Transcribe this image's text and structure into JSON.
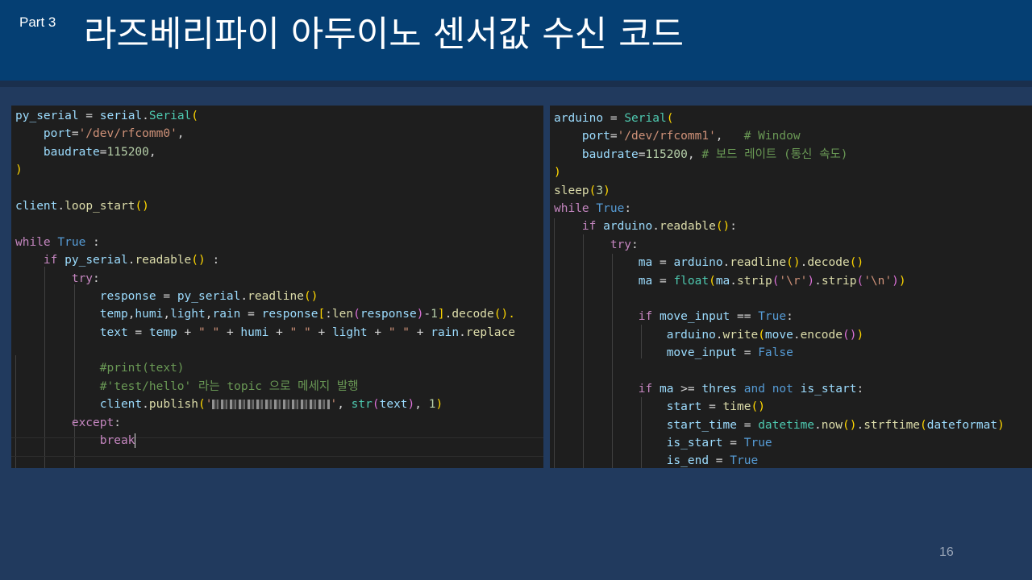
{
  "header": {
    "part_label": "Part 3",
    "title": "라즈베리파이 아두이노 센서값 수신 코드"
  },
  "left_code": {
    "l1": {
      "a": "py_serial",
      "b": " = ",
      "c": "serial",
      "d": ".",
      "e": "Serial",
      "f": "("
    },
    "l2": {
      "a": "    ",
      "b": "port",
      "c": "=",
      "d": "'/dev/rfcomm0'",
      "e": ","
    },
    "l3": {
      "a": "    ",
      "b": "baudrate",
      "c": "=",
      "d": "115200",
      "e": ","
    },
    "l4": {
      "a": ")"
    },
    "l6": {
      "a": "client",
      "b": ".",
      "c": "loop_start",
      "d": "()"
    },
    "l8": {
      "a": "while",
      "b": " ",
      "c": "True",
      "d": " :"
    },
    "l9": {
      "a": "    ",
      "b": "if",
      "c": " ",
      "d": "py_serial",
      "e": ".",
      "f": "readable",
      "g": "()",
      "h": " :"
    },
    "l10": {
      "a": "        ",
      "b": "try",
      "c": ":"
    },
    "l11": {
      "a": "            ",
      "b": "response",
      "c": " = ",
      "d": "py_serial",
      "e": ".",
      "f": "readline",
      "g": "()"
    },
    "l12": {
      "a": "            ",
      "b": "temp",
      "c": ",",
      "d": "humi",
      "e": ",",
      "f": "light",
      "g": ",",
      "h": "rain",
      "i": " = ",
      "j": "response",
      "k": "[",
      "l": ":",
      "m": "len",
      "n": "(",
      "o": "response",
      "p": ")",
      "q": "-",
      "r": "1",
      "s": "]",
      "t": ".",
      "u": "decode",
      "v": "().",
      "w": ""
    },
    "l13": {
      "a": "            ",
      "b": "text",
      "c": " = ",
      "d": "temp",
      "e": " + ",
      "f": "\" \"",
      "g": " + ",
      "h": "humi",
      "i": " + ",
      "j": "\" \"",
      "k": " + ",
      "l": "light",
      "m": " + ",
      "n": "\" \"",
      "o": " + ",
      "p": "rain",
      "q": ".",
      "r": "replace"
    },
    "l15": {
      "a": "            ",
      "b": "#print(text)"
    },
    "l16": {
      "a": "            ",
      "b": "#'test/hello' 라는 topic 으로 메세지 발행"
    },
    "l17": {
      "a": "            ",
      "b": "client",
      "c": ".",
      "d": "publish",
      "e": "(",
      "f": "'",
      "g": "'",
      "h": ", ",
      "i": "str",
      "j": "(",
      "k": "text",
      "l": ")",
      "m": ", ",
      "n": "1",
      "o": ")"
    },
    "l18": {
      "a": "        ",
      "b": "except",
      "c": ":"
    },
    "l19": {
      "a": "            ",
      "b": "break"
    }
  },
  "right_code": {
    "r1": {
      "a": "arduino",
      "b": " = ",
      "c": "Serial",
      "d": "("
    },
    "r2": {
      "a": "    ",
      "b": "port",
      "c": "=",
      "d": "'/dev/rfcomm1'",
      "e": ",   ",
      "f": "# Window"
    },
    "r3": {
      "a": "    ",
      "b": "baudrate",
      "c": "=",
      "d": "115200",
      "e": ", ",
      "f": "# 보드 레이트 (통신 속도)"
    },
    "r4": {
      "a": ")"
    },
    "r5": {
      "a": "sleep",
      "b": "(",
      "c": "3",
      "d": ")"
    },
    "r6": {
      "a": "while",
      "b": " ",
      "c": "True",
      "d": ":"
    },
    "r7": {
      "a": "    ",
      "b": "if",
      "c": " ",
      "d": "arduino",
      "e": ".",
      "f": "readable",
      "g": "()",
      "h": ":"
    },
    "r8": {
      "a": "        ",
      "b": "try",
      "c": ":"
    },
    "r9": {
      "a": "            ",
      "b": "ma",
      "c": " = ",
      "d": "arduino",
      "e": ".",
      "f": "readline",
      "g": "()",
      "h": ".",
      "i": "decode",
      "j": "()"
    },
    "r10": {
      "a": "            ",
      "b": "ma",
      "c": " = ",
      "d": "float",
      "e": "(",
      "f": "ma",
      "g": ".",
      "h": "strip",
      "i": "(",
      "j": "'\\r'",
      "k": ")",
      "l": ".",
      "m": "strip",
      "n": "(",
      "o": "'\\n'",
      "p": ")",
      "q": ")"
    },
    "r12": {
      "a": "            ",
      "b": "if",
      "c": " ",
      "d": "move_input",
      "e": " == ",
      "f": "True",
      "g": ":"
    },
    "r13": {
      "a": "                ",
      "b": "arduino",
      "c": ".",
      "d": "write",
      "e": "(",
      "f": "move",
      "g": ".",
      "h": "encode",
      "i": "()",
      "j": ")"
    },
    "r14": {
      "a": "                ",
      "b": "move_input",
      "c": " = ",
      "d": "False"
    },
    "r16": {
      "a": "            ",
      "b": "if",
      "c": " ",
      "d": "ma",
      "e": " >= ",
      "f": "thres",
      "g": " ",
      "h": "and",
      "i": " ",
      "j": "not",
      "k": " ",
      "l": "is_start",
      "m": ":"
    },
    "r17": {
      "a": "                ",
      "b": "start",
      "c": " = ",
      "d": "time",
      "e": "()"
    },
    "r18": {
      "a": "                ",
      "b": "start_time",
      "c": " = ",
      "d": "datetime",
      "e": ".",
      "f": "now",
      "g": "()",
      "h": ".",
      "i": "strftime",
      "j": "(",
      "k": "dateformat",
      "l": ")"
    },
    "r19": {
      "a": "                ",
      "b": "is_start",
      "c": " = ",
      "d": "True"
    },
    "r20": {
      "a": "                ",
      "b": "is_end",
      "c": " = ",
      "d": "True"
    }
  },
  "footer": {
    "page_number": "16"
  },
  "colors": {
    "header_bg": "#053f73",
    "slide_bg": "#213a5e",
    "editor_bg": "#1e1e1e",
    "keyword_control": "#c586c0",
    "keyword_constant": "#569cd6",
    "function": "#dcdcaa",
    "class": "#4ec9b0",
    "variable": "#9cdcfe",
    "string": "#ce9178",
    "number": "#b5cea8",
    "comment": "#6a9955"
  }
}
